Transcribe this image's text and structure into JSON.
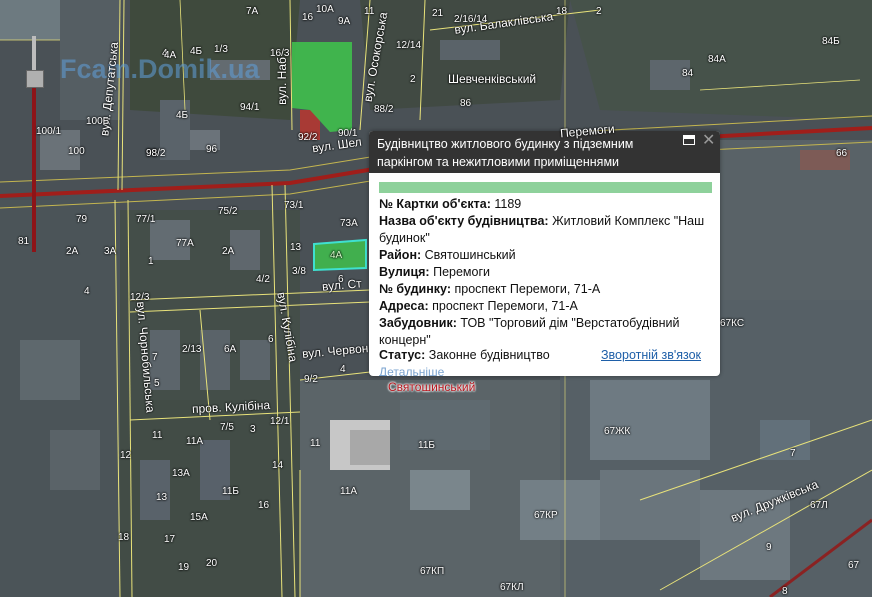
{
  "watermark": "Fcam.Domik.ua",
  "map": {
    "streets": [
      {
        "id": "vul-prosp-peremogy-left",
        "text": "вул. Депутатська"
      },
      {
        "id": "vul-naberezhna",
        "text": "вул. Наб"
      },
      {
        "id": "vul-ocheretova",
        "text": "вул. Осокорська"
      },
      {
        "id": "vul-shel",
        "text": "вул. Шел"
      },
      {
        "id": "vul-balaklivska",
        "text": "вул. Балаклівська"
      },
      {
        "id": "vul-kulibina-v",
        "text": "вул. Кулібіна"
      },
      {
        "id": "vul-chornobylska",
        "text": "вул. Чорнобильська"
      },
      {
        "id": "vul-chervonoarm",
        "text": "вул. Червон"
      },
      {
        "id": "vul-st",
        "text": "вул. Ст"
      },
      {
        "id": "prov-kulibina",
        "text": "пров. Кулібіна"
      },
      {
        "id": "vul-druzhby",
        "text": "вул. Дружківська"
      },
      {
        "id": "prosp-peremohy-1",
        "text": "Перемоги"
      }
    ],
    "districts": [
      {
        "id": "shevchenkivskyi",
        "text": "Шевченківський"
      },
      {
        "id": "sviatoshynskyi",
        "text": "Святошинський"
      }
    ],
    "house_numbers": [
      "7А",
      "10А",
      "9А",
      "11",
      "21",
      "2/16/14",
      "16",
      "18",
      "2",
      "4",
      "1/3",
      "4А",
      "4Б",
      "16/3",
      "2",
      "12/14",
      "84Б",
      "94/1",
      "4Б",
      "98",
      "100Б",
      "100/1",
      "100",
      "98/2",
      "96",
      "92/2",
      "90/1",
      "88/2",
      "86",
      "84",
      "84А",
      "73/1",
      "75/2",
      "77/1",
      "77А",
      "2А",
      "3А",
      "2А",
      "1",
      "4",
      "12/3",
      "79",
      "81",
      "6",
      "7",
      "6А",
      "2/13",
      "5",
      "7/5",
      "3",
      "12/1",
      "11",
      "11А",
      "11Б",
      "12",
      "13А",
      "14",
      "13",
      "15А",
      "16",
      "17",
      "18",
      "19",
      "20",
      "13",
      "3/8",
      "4/2",
      "73А",
      "6",
      "9/2",
      "4",
      "11",
      "11Б",
      "11А",
      "67КС",
      "67ЖК",
      "67КР",
      "67КП",
      "67КЛ",
      "67Л",
      "66",
      "7",
      "9",
      "67",
      "8"
    ]
  },
  "popup": {
    "title": "Будівництво житлового будинку з підземним паркінгом та нежитловими приміщеннями",
    "fields": [
      {
        "label": "№ Картки об'єкта:",
        "value": "1189"
      },
      {
        "label": "Назва об'єкту будівництва:",
        "value": "Житловий Комплекс \"Наш будинок\""
      },
      {
        "label": "Район:",
        "value": "Святошинський"
      },
      {
        "label": "Вулиця:",
        "value": "Перемоги"
      },
      {
        "label": "№ будинку:",
        "value": "проспект Перемоги, 71-А"
      },
      {
        "label": "Адреса:",
        "value": "проспект Перемоги, 71-А"
      },
      {
        "label": "Забудовник:",
        "value": "ТОВ \"Торговий дім \"Верстатобудівний концерн\""
      }
    ],
    "status_label": "Статус:",
    "status_value": "Законне будівництво",
    "feedback_link": "Зворотній зв'язок",
    "details_link": "Детальніше",
    "status_color": "#8ed19b"
  },
  "polygon_label": "4А",
  "colors": {
    "main_road": "#a01e1a",
    "street_line": "#e8e27a",
    "highlight_green": "#3fbf4c",
    "selected_outline": "#3fe0d0"
  }
}
